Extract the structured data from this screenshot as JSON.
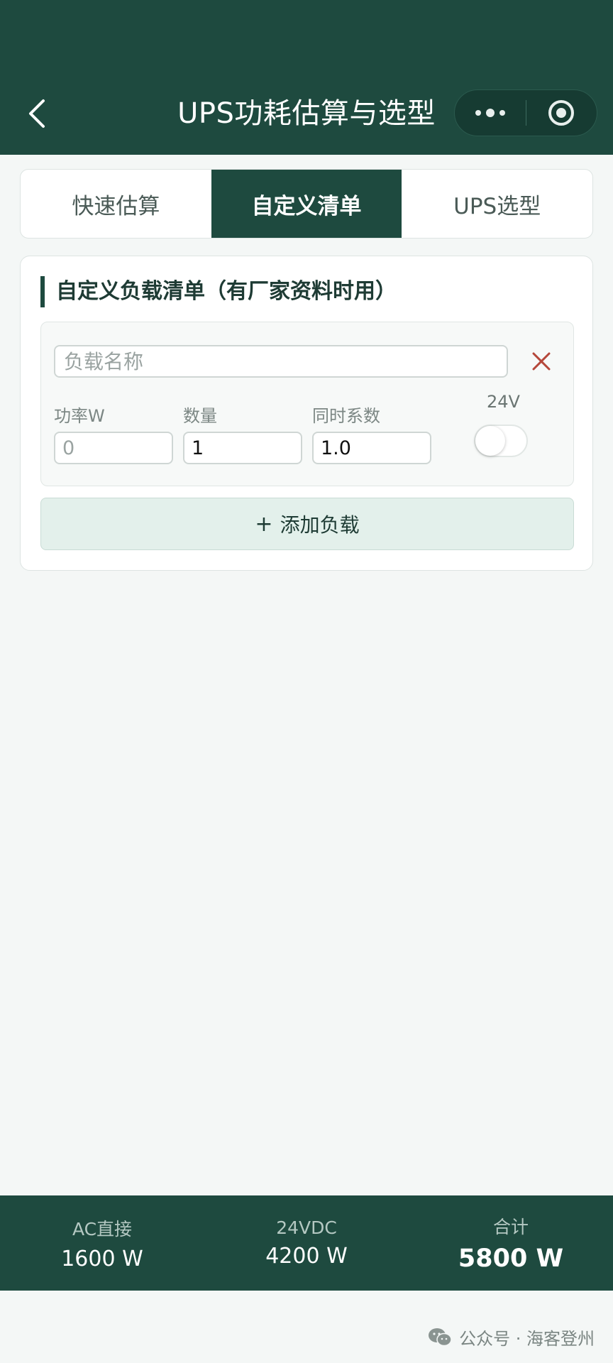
{
  "header": {
    "title": "UPS功耗估算与选型"
  },
  "tabs": [
    {
      "label": "快速估算",
      "active": false
    },
    {
      "label": "自定义清单",
      "active": true
    },
    {
      "label": "UPS选型",
      "active": false
    }
  ],
  "section": {
    "title": "自定义负载清单（有厂家资料时用）"
  },
  "load_item": {
    "name_placeholder": "负载名称",
    "name_value": "",
    "power_label": "功率W",
    "power_value": "0",
    "quantity_label": "数量",
    "quantity_value": "1",
    "factor_label": "同时系数",
    "factor_value": "1.0",
    "toggle_label": "24V",
    "toggle_on": false
  },
  "add_button": {
    "plus": "+",
    "label": "添加负载"
  },
  "summary": {
    "ac": {
      "label": "AC直接",
      "value": "1600 W"
    },
    "dc": {
      "label": "24VDC",
      "value": "4200 W"
    },
    "total": {
      "label": "合计",
      "value": "5800 W"
    }
  },
  "watermark": {
    "text": "公众号 · 海客登州"
  },
  "colors": {
    "primary": "#1e4a3f",
    "background": "#f4f7f6",
    "danger": "#c0392b",
    "add_bg": "#e3f0eb"
  }
}
